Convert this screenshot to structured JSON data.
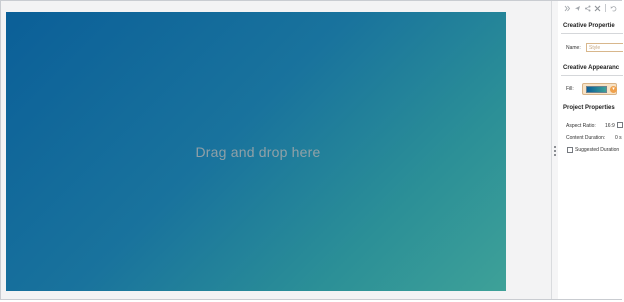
{
  "canvas": {
    "drop_text": "Drag and drop here"
  },
  "toolbar": {
    "icons": [
      "skip-icon",
      "send-icon",
      "share-icon",
      "close-x-icon",
      "undo-icon"
    ]
  },
  "sections": {
    "creative_properties": "Creative Propertie",
    "creative_appearance": "Creative Appearanc",
    "project_properties": "Project Properties"
  },
  "creative_properties": {
    "name_label": "Name:",
    "name_placeholder": "Style"
  },
  "creative_appearance": {
    "fill_label": "Fill:"
  },
  "project_properties": {
    "aspect_label": "Aspect Ratio:",
    "aspect_value": "16:9",
    "content_duration_label": "Content Duration:",
    "content_duration_value": "0 s",
    "suggested_duration_label": "Suggested Duration"
  },
  "colors": {
    "canvas_gradient_start": "#0b5f98",
    "canvas_gradient_end": "#3ea198",
    "accent": "#f0a14c"
  }
}
